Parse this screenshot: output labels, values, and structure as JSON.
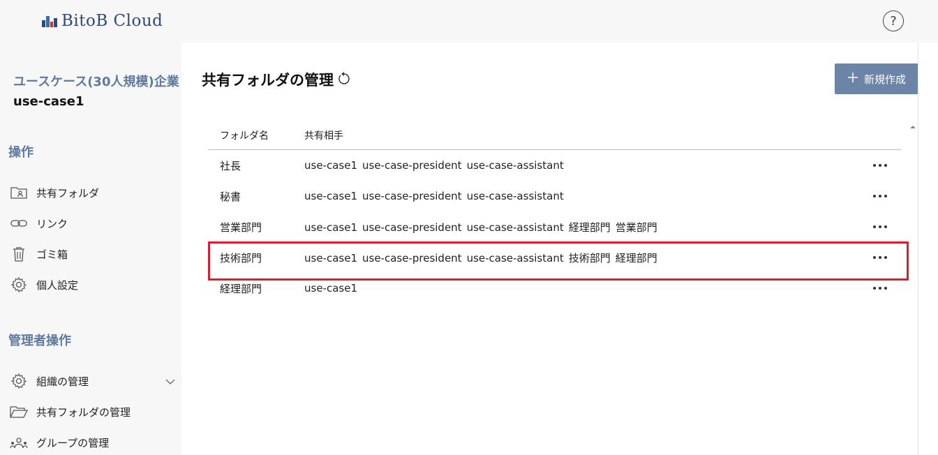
{
  "header": {
    "logo_text": "BitoB Cloud",
    "help_label": "?"
  },
  "sidebar": {
    "org_name": "ユースケース(30人規模)企業",
    "user_name": "use-case1",
    "operations_title": "操作",
    "operations": [
      {
        "label": "共有フォルダ",
        "icon": "shared-folder-icon"
      },
      {
        "label": "リンク",
        "icon": "link-icon"
      },
      {
        "label": "ゴミ箱",
        "icon": "trash-icon"
      },
      {
        "label": "個人設定",
        "icon": "gear-icon"
      }
    ],
    "admin_title": "管理者操作",
    "admin": [
      {
        "label": "組織の管理",
        "icon": "gear-icon"
      },
      {
        "label": "共有フォルダの管理",
        "icon": "folder-open-icon"
      },
      {
        "label": "グループの管理",
        "icon": "group-icon"
      }
    ]
  },
  "main": {
    "title": "共有フォルダの管理",
    "new_button": "新規作成",
    "table": {
      "headers": {
        "name": "フォルダ名",
        "share": "共有相手"
      },
      "rows": [
        {
          "name": "社長",
          "share": [
            "use-case1",
            "use-case-president",
            "use-case-assistant"
          ]
        },
        {
          "name": "秘書",
          "share": [
            "use-case1",
            "use-case-president",
            "use-case-assistant"
          ]
        },
        {
          "name": "営業部門",
          "share": [
            "use-case1",
            "use-case-president",
            "use-case-assistant",
            "経理部門",
            "営業部門"
          ]
        },
        {
          "name": "技術部門",
          "share": [
            "use-case1",
            "use-case-president",
            "use-case-assistant",
            "技術部門",
            "経理部門"
          ]
        },
        {
          "name": "経理部門",
          "share": [
            "use-case1"
          ]
        }
      ]
    }
  },
  "colors": {
    "accent": "#6b84a8",
    "section_title": "#5f7a9e",
    "logo": "#2f4a78",
    "highlight": "#e21b2c"
  }
}
